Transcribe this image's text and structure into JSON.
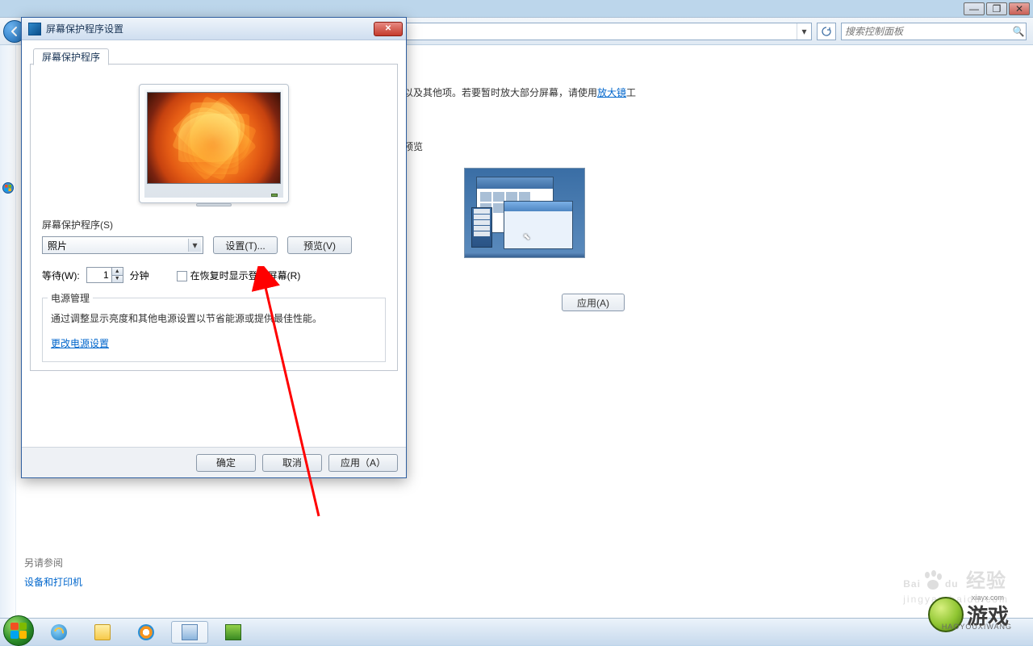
{
  "titlebar": {
    "min": "—",
    "max": "❐",
    "close": "✕"
  },
  "header": {
    "search_placeholder": "搜索控制面板"
  },
  "main": {
    "description_prefix": "以及其他项。若要暂时放大部分屏幕，请使用",
    "magnifier_link": "放大镜",
    "description_suffix": "工",
    "preview_label": "预览",
    "apply": "应用(A)"
  },
  "sidebar_footer": {
    "see_also": "另请参阅",
    "devices": "设备和打印机"
  },
  "dialog": {
    "title": "屏幕保护程序设置",
    "tab": "屏幕保护程序",
    "ss_label": "屏幕保护程序(S)",
    "ss_selected": "照片",
    "settings_btn": "设置(T)...",
    "preview_btn": "预览(V)",
    "wait_label": "等待(W):",
    "wait_value": "1",
    "wait_unit": "分钟",
    "resume_checkbox": "在恢复时显示登录屏幕(R)",
    "power_group": "电源管理",
    "power_text": "通过调整显示亮度和其他电源设置以节省能源或提供最佳性能。",
    "power_link": "更改电源设置",
    "ok": "确定",
    "cancel": "取消",
    "apply": "应用（A）"
  },
  "watermark": {
    "baidu": "Bai",
    "du": "du",
    "jy": "经验",
    "sub": "jingyan.baidu.com",
    "logo_text": "游戏",
    "logo_sub": "HAOYOUXIWANG",
    "logo_url": "xiayx.com"
  }
}
